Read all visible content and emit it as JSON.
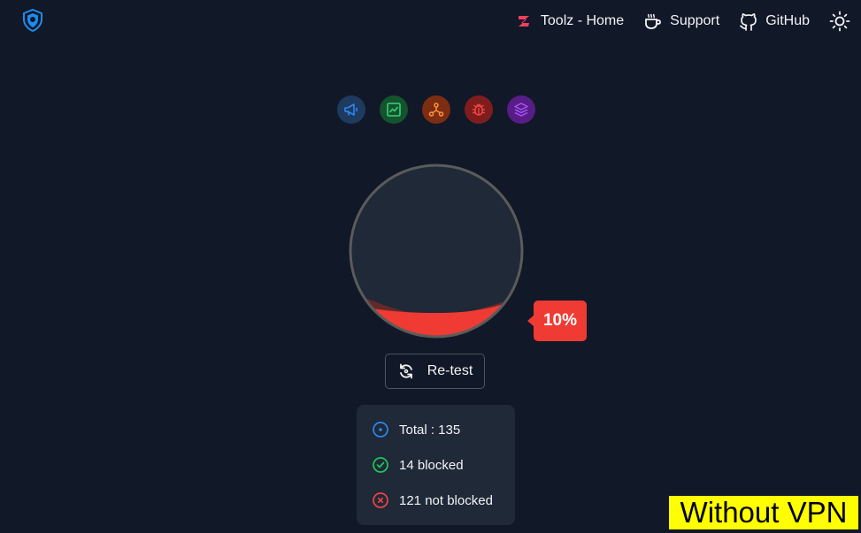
{
  "header": {
    "logo_icon": "shield-logo-icon",
    "nav": [
      {
        "label": "Toolz - Home",
        "icon": "toolz-icon"
      },
      {
        "label": "Support",
        "icon": "coffee-icon"
      },
      {
        "label": "GitHub",
        "icon": "github-icon"
      }
    ],
    "theme_icon": "sun-icon"
  },
  "categories": [
    {
      "icon": "megaphone-icon",
      "color": "#1d6fe0"
    },
    {
      "icon": "chart-icon",
      "color": "#22c55e"
    },
    {
      "icon": "network-icon",
      "color": "#f97316"
    },
    {
      "icon": "bug-icon",
      "color": "#ef4444"
    },
    {
      "icon": "layers-icon",
      "color": "#a855f7"
    }
  ],
  "gauge": {
    "percent_label": "10%",
    "fill_fraction": 0.1,
    "fill_color": "#ef3b33"
  },
  "retest": {
    "label": "Re-test",
    "icon": "refresh-icon"
  },
  "stats": {
    "total": "Total : 135",
    "blocked": "14 blocked",
    "not_blocked": "121 not blocked"
  },
  "overlay": {
    "label": "Without VPN"
  },
  "colors": {
    "background": "#111827",
    "card": "#1f2937",
    "accent_red": "#ef3b33",
    "accent_green": "#22c55e",
    "accent_blue": "#1d6fe0"
  }
}
